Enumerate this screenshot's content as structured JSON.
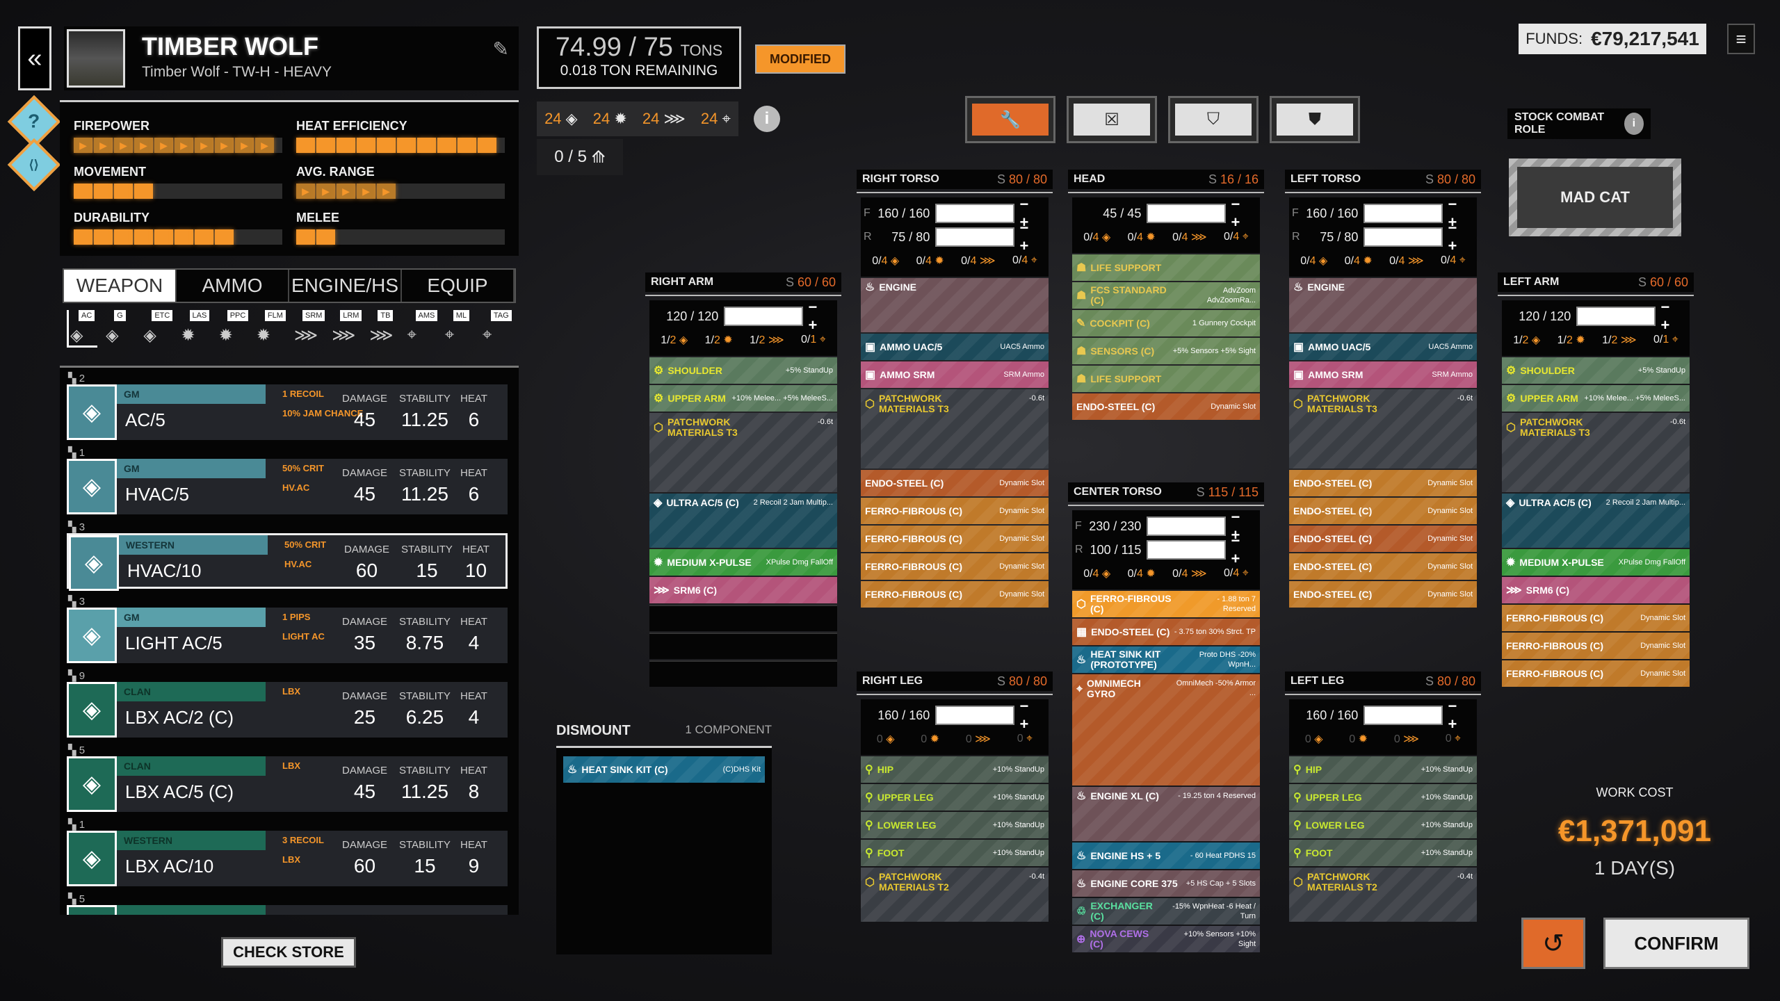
{
  "header": {
    "back_icon": "double-chevron-left",
    "mech_name": "TIMBER WOLF",
    "mech_subtitle": "Timber Wolf - TW-H - HEAVY",
    "edit_icon": "edit-icon"
  },
  "side_buttons": [
    {
      "icon": "help-icon",
      "glyph": "?"
    },
    {
      "icon": "link-icon",
      "glyph": "⟨⟩"
    }
  ],
  "stats": [
    {
      "label": "FIREPOWER",
      "value": 10,
      "max": 10,
      "style": "arrow"
    },
    {
      "label": "HEAT EFFICIENCY",
      "value": 10,
      "max": 10,
      "style": "solid"
    },
    {
      "label": "MOVEMENT",
      "value": 4,
      "max": 10,
      "style": "solid"
    },
    {
      "label": "AVG. RANGE",
      "value": 5,
      "max": 10,
      "style": "arrow"
    },
    {
      "label": "DURABILITY",
      "value": 8,
      "max": 10,
      "style": "solid"
    },
    {
      "label": "MELEE",
      "value": 2,
      "max": 10,
      "style": "solid"
    }
  ],
  "tabs": [
    "WEAPON",
    "AMMO",
    "ENGINE/HS",
    "EQUIP"
  ],
  "active_tab": 0,
  "filters": [
    "AC",
    "G",
    "ETC",
    "LAS",
    "PPC",
    "FLM",
    "SRM",
    "LRM",
    "TB",
    "AMS",
    "ML",
    "TAG"
  ],
  "weapons": [
    {
      "count": "2",
      "faction": "GM",
      "name": "AC/5",
      "tag1": "1 RECOIL",
      "tag2": "10% JAM CHANCE",
      "damage": "45",
      "stability": "11.25",
      "heat": "6",
      "color": "#4a8a96"
    },
    {
      "count": "1",
      "faction": "GM",
      "name": "HVAC/5",
      "tag1": "50% CRIT",
      "tag2": "HV.AC",
      "damage": "45",
      "stability": "11.25",
      "heat": "6",
      "color": "#4a8a96"
    },
    {
      "count": "3",
      "faction": "WESTERN",
      "name": "HVAC/10",
      "tag1": "50% CRIT",
      "tag2": "HV.AC",
      "damage": "60",
      "stability": "15",
      "heat": "10",
      "color": "#4a8a96",
      "selected": true
    },
    {
      "count": "3",
      "faction": "GM",
      "name": "LIGHT AC/5",
      "tag1": "1 PIPS",
      "tag2": "LIGHT AC",
      "damage": "35",
      "stability": "8.75",
      "heat": "4",
      "color": "#5aa0aa"
    },
    {
      "count": "9",
      "faction": "CLAN",
      "name": "LBX AC/2 (C)",
      "tag1": "LBX",
      "tag2": "",
      "damage": "25",
      "stability": "6.25",
      "heat": "4",
      "color": "#1e6a56"
    },
    {
      "count": "5",
      "faction": "CLAN",
      "name": "LBX AC/5 (C)",
      "tag1": "LBX",
      "tag2": "",
      "damage": "45",
      "stability": "11.25",
      "heat": "8",
      "color": "#1e6a56"
    },
    {
      "count": "1",
      "faction": "WESTERN",
      "name": "LBX AC/10",
      "tag1": "3 RECOIL",
      "tag2": "LBX",
      "damage": "60",
      "stability": "15",
      "heat": "9",
      "color": "#1e6a56"
    },
    {
      "count": "5",
      "faction": "",
      "name": "",
      "tag1": "",
      "tag2": "",
      "damage": "",
      "stability": "",
      "heat": "",
      "color": "#1e6a56"
    }
  ],
  "weapon_col_labels": {
    "damage": "DAMAGE",
    "stability": "STABILITY",
    "heat": "HEAT"
  },
  "check_store": "CHECK STORE",
  "tonnage": {
    "value": "74.99 / 75",
    "unit": "TONS",
    "remaining": "0.018 TON REMAINING"
  },
  "modified_badge": "MODIFIED",
  "hardpoints": [
    {
      "count": "24",
      "icon": "ballistic-icon"
    },
    {
      "count": "24",
      "icon": "energy-icon"
    },
    {
      "count": "24",
      "icon": "missile-icon"
    },
    {
      "count": "24",
      "icon": "support-icon"
    }
  ],
  "omnipods": "0 / 5",
  "mode_buttons": [
    {
      "icon": "wrench-icon",
      "glyph": "🔧",
      "active": true
    },
    {
      "icon": "remove-structure-icon",
      "glyph": "☒"
    },
    {
      "icon": "remove-armor-icon",
      "glyph": "⛉"
    },
    {
      "icon": "armor-icon",
      "glyph": "⛊"
    }
  ],
  "funds": {
    "label": "FUNDS:",
    "value": "€79,217,541"
  },
  "stock_role": {
    "label": "STOCK COMBAT ROLE",
    "value": "MAD CAT"
  },
  "components": {
    "right_arm": {
      "title": "RIGHT ARM",
      "s": "60 / 60",
      "armor": [
        {
          "fr": "",
          "v": "120 / 120"
        }
      ],
      "hp": [
        "1/2",
        "1/2",
        "1/2",
        "0/1"
      ],
      "slots": [
        {
          "name": "SHOULDER",
          "desc": "+5% StandUp",
          "c": "c-green",
          "icon": "shoulder-icon",
          "g": "⚙"
        },
        {
          "name": "UPPER ARM",
          "desc": "+10% Melee... +5% MeleeS...",
          "c": "c-green",
          "icon": "arm-icon",
          "g": "⚙"
        },
        {
          "name": "PATCHWORK MATERIALS T3",
          "desc": "-0.6t",
          "c": "c-grey tall3",
          "icon": "armor-shield-icon",
          "g": "⬡"
        },
        {
          "name": "ULTRA AC/5 (C)",
          "desc": "2 Recoil 2 Jam Multip...",
          "c": "c-teal tall2",
          "icon": "ballistic-icon",
          "g": "◈"
        },
        {
          "name": "MEDIUM X-PULSE",
          "desc": "XPulse Dmg FallOff",
          "c": "c-lime",
          "icon": "energy-icon",
          "g": "✹"
        },
        {
          "name": "SRM6 (C)",
          "desc": "",
          "c": "c-pink",
          "icon": "missile-icon",
          "g": "⋙"
        },
        {
          "empty": true
        },
        {
          "empty": true
        },
        {
          "empty": true
        }
      ]
    },
    "right_torso": {
      "title": "RIGHT TORSO",
      "s": "80 / 80",
      "armor": [
        {
          "fr": "F",
          "v": "160 / 160"
        },
        {
          "fr": "R",
          "v": "75 / 80"
        }
      ],
      "hp": [
        "0/4",
        "0/4",
        "0/4",
        "0/4"
      ],
      "slots": [
        {
          "name": "ENGINE",
          "desc": "",
          "c": "c-brown tall2",
          "icon": "engine-icon",
          "g": "♨"
        },
        {
          "name": "AMMO UAC/5",
          "desc": "UAC5 Ammo",
          "c": "c-teal",
          "icon": "ammo-icon",
          "g": "▣"
        },
        {
          "name": "AMMO SRM",
          "desc": "SRM Ammo",
          "c": "c-pink",
          "icon": "missile-ammo-icon",
          "g": "▣"
        },
        {
          "name": "PATCHWORK MATERIALS T3",
          "desc": "-0.6t",
          "c": "c-grey tall3",
          "icon": "armor-shield-icon",
          "g": "⬡"
        },
        {
          "name": "ENDO-STEEL (C)",
          "desc": "Dynamic Slot",
          "c": "c-rust"
        },
        {
          "name": "FERRO-FIBROUS (C)",
          "desc": "Dynamic Slot",
          "c": "c-gold"
        },
        {
          "name": "FERRO-FIBROUS (C)",
          "desc": "Dynamic Slot",
          "c": "c-gold"
        },
        {
          "name": "FERRO-FIBROUS (C)",
          "desc": "Dynamic Slot",
          "c": "c-gold"
        },
        {
          "name": "FERRO-FIBROUS (C)",
          "desc": "Dynamic Slot",
          "c": "c-gold"
        }
      ]
    },
    "head": {
      "title": "HEAD",
      "s": "16 / 16",
      "armor": [
        {
          "fr": "",
          "v": "45 / 45"
        }
      ],
      "hp": [
        "0/4",
        "0/4",
        "0/4",
        "0/4"
      ],
      "slots": [
        {
          "name": "LIFE SUPPORT",
          "desc": "",
          "c": "c-life",
          "icon": "life-support-icon",
          "g": "☗"
        },
        {
          "name": "FCS STANDARD (C)",
          "desc": "AdvZoom AdvZoomRa...",
          "c": "c-life",
          "icon": "fcs-icon",
          "g": "☗"
        },
        {
          "name": "COCKPIT (C)",
          "desc": "1 Gunnery Cockpit",
          "c": "c-life",
          "icon": "cockpit-icon",
          "g": "✎"
        },
        {
          "name": "SENSORS (C)",
          "desc": "+5% Sensors +5% Sight",
          "c": "c-life",
          "icon": "sensors-icon",
          "g": "☗"
        },
        {
          "name": "LIFE SUPPORT",
          "desc": "",
          "c": "c-life",
          "icon": "life-support-icon",
          "g": "☗"
        },
        {
          "name": "ENDO-STEEL (C)",
          "desc": "Dynamic Slot",
          "c": "c-rust"
        }
      ]
    },
    "center_torso": {
      "title": "CENTER TORSO",
      "s": "115 / 115",
      "armor": [
        {
          "fr": "F",
          "v": "230 / 230"
        },
        {
          "fr": "R",
          "v": "100 / 115"
        }
      ],
      "hp": [
        "0/4",
        "0/4",
        "0/4",
        "0/4"
      ],
      "slots": [
        {
          "name": "FERRO-FIBROUS (C)",
          "desc": "- 1.88 ton 7 Reserved",
          "c": "c-orange",
          "icon": "ferro-icon",
          "g": "⬡"
        },
        {
          "name": "ENDO-STEEL (C)",
          "desc": "- 3.75 ton 30% Strct. TP",
          "c": "c-rust",
          "icon": "endo-icon",
          "g": "▦"
        },
        {
          "name": "HEAT SINK KIT (PROTOTYPE)",
          "desc": "Proto DHS -20% WpnH...",
          "c": "c-blue",
          "icon": "heatsink-icon",
          "g": "♨"
        },
        {
          "name": "OMNIMECH GYRO",
          "desc": "OmniMech -50% Armor ...",
          "c": "c-rust tall4",
          "icon": "gyro-icon",
          "g": "⌖"
        },
        {
          "name": "ENGINE XL (C)",
          "desc": "- 19.25 ton 4 Reserved",
          "c": "c-brown tall2",
          "icon": "engine-icon",
          "g": "♨"
        },
        {
          "name": "ENGINE HS + 5",
          "desc": "- 60 Heat PDHS 15",
          "c": "c-blue",
          "icon": "heatsink-icon",
          "g": "♨"
        },
        {
          "name": "ENGINE CORE 375",
          "desc": "+5 HS Cap + 5 Slots",
          "c": "c-brown",
          "icon": "engine-core-icon",
          "g": "♨"
        },
        {
          "name": "EXCHANGER (C)",
          "desc": "-15% WpnHeat -6 Heat / Turn",
          "c": "c-exch",
          "icon": "exchanger-icon",
          "g": "♲"
        },
        {
          "name": "NOVA CEWS (C)",
          "desc": "+10% Sensors +10% Sight",
          "c": "c-nova",
          "icon": "cews-icon",
          "g": "⊕"
        }
      ]
    },
    "left_torso": {
      "title": "LEFT TORSO",
      "s": "80 / 80",
      "armor": [
        {
          "fr": "F",
          "v": "160 / 160"
        },
        {
          "fr": "R",
          "v": "75 / 80"
        }
      ],
      "hp": [
        "0/4",
        "0/4",
        "0/4",
        "0/4"
      ],
      "slots": [
        {
          "name": "ENGINE",
          "desc": "",
          "c": "c-brown tall2",
          "icon": "engine-icon",
          "g": "♨"
        },
        {
          "name": "AMMO UAC/5",
          "desc": "UAC5 Ammo",
          "c": "c-teal",
          "icon": "ammo-icon",
          "g": "▣"
        },
        {
          "name": "AMMO SRM",
          "desc": "SRM Ammo",
          "c": "c-pink",
          "icon": "missile-ammo-icon",
          "g": "▣"
        },
        {
          "name": "PATCHWORK MATERIALS T3",
          "desc": "-0.6t",
          "c": "c-grey tall3",
          "icon": "armor-shield-icon",
          "g": "⬡"
        },
        {
          "name": "ENDO-STEEL (C)",
          "desc": "Dynamic Slot",
          "c": "c-gold"
        },
        {
          "name": "ENDO-STEEL (C)",
          "desc": "Dynamic Slot",
          "c": "c-gold"
        },
        {
          "name": "ENDO-STEEL (C)",
          "desc": "Dynamic Slot",
          "c": "c-rust"
        },
        {
          "name": "ENDO-STEEL (C)",
          "desc": "Dynamic Slot",
          "c": "c-gold"
        },
        {
          "name": "ENDO-STEEL (C)",
          "desc": "Dynamic Slot",
          "c": "c-gold"
        }
      ]
    },
    "left_arm": {
      "title": "LEFT ARM",
      "s": "60 / 60",
      "armor": [
        {
          "fr": "",
          "v": "120 / 120"
        }
      ],
      "hp": [
        "1/2",
        "1/2",
        "1/2",
        "0/1"
      ],
      "slots": [
        {
          "name": "SHOULDER",
          "desc": "+5% StandUp",
          "c": "c-green",
          "icon": "shoulder-icon",
          "g": "⚙"
        },
        {
          "name": "UPPER ARM",
          "desc": "+10% Melee... +5% MeleeS...",
          "c": "c-green",
          "icon": "arm-icon",
          "g": "⚙"
        },
        {
          "name": "PATCHWORK MATERIALS T3",
          "desc": "-0.6t",
          "c": "c-grey tall3",
          "icon": "armor-shield-icon",
          "g": "⬡"
        },
        {
          "name": "ULTRA AC/5 (C)",
          "desc": "2 Recoil 2 Jam Multip...",
          "c": "c-teal tall2",
          "icon": "ballistic-icon",
          "g": "◈"
        },
        {
          "name": "MEDIUM X-PULSE",
          "desc": "XPulse Dmg FallOff",
          "c": "c-lime",
          "icon": "energy-icon",
          "g": "✹"
        },
        {
          "name": "SRM6 (C)",
          "desc": "",
          "c": "c-pink",
          "icon": "missile-icon",
          "g": "⋙"
        },
        {
          "name": "FERRO-FIBROUS (C)",
          "desc": "Dynamic Slot",
          "c": "c-gold"
        },
        {
          "name": "FERRO-FIBROUS (C)",
          "desc": "Dynamic Slot",
          "c": "c-gold"
        },
        {
          "name": "FERRO-FIBROUS (C)",
          "desc": "Dynamic Slot",
          "c": "c-gold"
        }
      ]
    },
    "right_leg": {
      "title": "RIGHT LEG",
      "s": "80 / 80",
      "armor": [
        {
          "fr": "",
          "v": "160 / 160"
        }
      ],
      "hp": [
        "0",
        "0",
        "0",
        "0"
      ],
      "hp_dim": true,
      "slots": [
        {
          "name": "HIP",
          "desc": "+10% StandUp",
          "c": "c-ltgreen",
          "icon": "leg-actuator-icon",
          "g": "⚲"
        },
        {
          "name": "UPPER LEG",
          "desc": "+10% StandUp",
          "c": "c-ltgreen",
          "icon": "leg-actuator-icon",
          "g": "⚲"
        },
        {
          "name": "LOWER LEG",
          "desc": "+10% StandUp",
          "c": "c-ltgreen",
          "icon": "leg-actuator-icon",
          "g": "⚲"
        },
        {
          "name": "FOOT",
          "desc": "+10% StandUp",
          "c": "c-ltgreen",
          "icon": "leg-actuator-icon",
          "g": "⚲"
        },
        {
          "name": "PATCHWORK MATERIALS T2",
          "desc": "-0.4t",
          "c": "c-grey tall2",
          "icon": "armor-shield-icon",
          "g": "⬡"
        }
      ]
    },
    "left_leg": {
      "title": "LEFT LEG",
      "s": "80 / 80",
      "armor": [
        {
          "fr": "",
          "v": "160 / 160"
        }
      ],
      "hp": [
        "0",
        "0",
        "0",
        "0"
      ],
      "hp_dim": true,
      "slots": [
        {
          "name": "HIP",
          "desc": "+10% StandUp",
          "c": "c-ltgreen",
          "icon": "leg-actuator-icon",
          "g": "⚲"
        },
        {
          "name": "UPPER LEG",
          "desc": "+10% StandUp",
          "c": "c-ltgreen",
          "icon": "leg-actuator-icon",
          "g": "⚲"
        },
        {
          "name": "LOWER LEG",
          "desc": "+10% StandUp",
          "c": "c-ltgreen",
          "icon": "leg-actuator-icon",
          "g": "⚲"
        },
        {
          "name": "FOOT",
          "desc": "+10% StandUp",
          "c": "c-ltgreen",
          "icon": "leg-actuator-icon",
          "g": "⚲"
        },
        {
          "name": "PATCHWORK MATERIALS T2",
          "desc": "-0.4t",
          "c": "c-grey tall2",
          "icon": "armor-shield-icon",
          "g": "⬡"
        }
      ]
    }
  },
  "dismount": {
    "title": "DISMOUNT",
    "count": "1 COMPONENT",
    "items": [
      {
        "name": "HEAT SINK KIT (C)",
        "desc": "(C)DHS Kit",
        "c": "c-blue",
        "icon": "heatsink-icon",
        "g": "♨"
      }
    ]
  },
  "work_cost": {
    "label": "WORK COST",
    "value": "€1,371,091",
    "duration": "1 DAY(S)"
  },
  "confirm_label": "CONFIRM",
  "hp_glyphs": [
    "◈",
    "✹",
    "⋙",
    "⌖"
  ]
}
